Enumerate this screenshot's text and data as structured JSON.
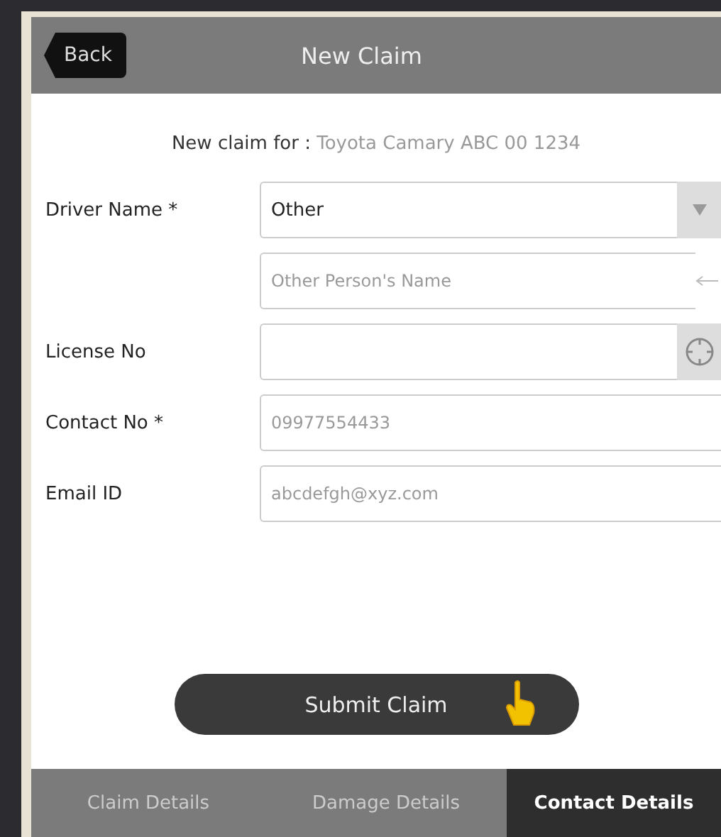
{
  "header": {
    "back": "Back",
    "title": "New Claim"
  },
  "subtitle": {
    "label": "New claim for :",
    "vehicle": "Toyota Camary ABC 00 1234"
  },
  "fields": [
    {
      "label": "Driver Name *",
      "kind": "select",
      "value": "Other"
    },
    {
      "kind": "text",
      "placeholder": "Other Person's Name"
    },
    {
      "label": "License No",
      "kind": "scan"
    },
    {
      "label": "Contact No *",
      "kind": "plain",
      "placeholder": "09977554433"
    },
    {
      "label": "Email ID",
      "kind": "plain",
      "placeholder": "abcdefgh@xyz.com"
    }
  ],
  "submit": "Submit Claim",
  "tabs": [
    {
      "label": "Claim Details",
      "selected": false
    },
    {
      "label": "Damage Details",
      "selected": false
    },
    {
      "label": "Contact Details",
      "selected": true
    }
  ]
}
